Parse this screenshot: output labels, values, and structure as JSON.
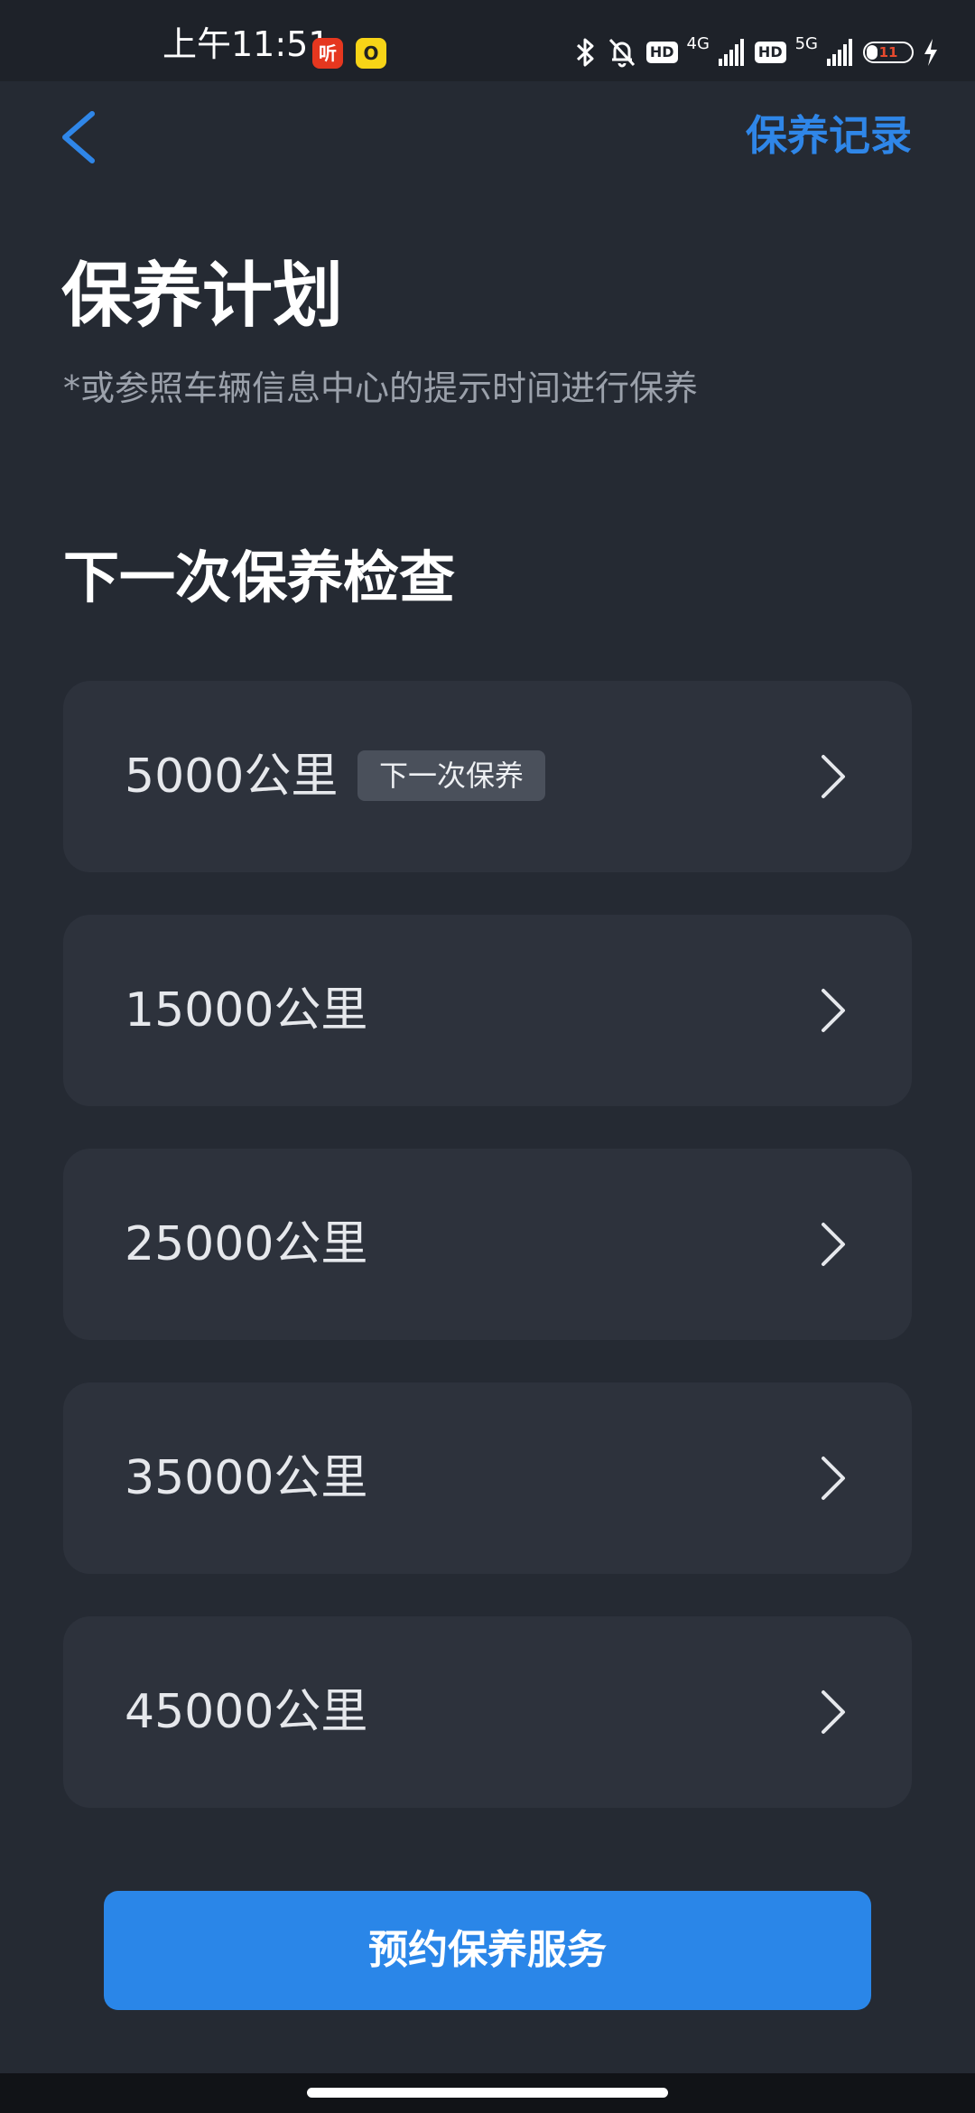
{
  "status_bar": {
    "time": "上午11:51",
    "app_badges": [
      "听",
      "O"
    ],
    "hd_label": "HD",
    "network_4g": "4G",
    "network_5g": "5G",
    "battery_level": "11",
    "icons": [
      "bluetooth-icon",
      "bell-muted-icon",
      "signal-icon",
      "battery-icon",
      "charging-icon"
    ]
  },
  "header": {
    "back_icon": "chevron-left-icon",
    "records_label": "保养记录"
  },
  "page": {
    "title": "保养计划",
    "subtitle": "*或参照车辆信息中心的提示时间进行保养"
  },
  "section": {
    "title": "下一次保养检查"
  },
  "plans": [
    {
      "label": "5000公里",
      "tag": "下一次保养"
    },
    {
      "label": "15000公里",
      "tag": null
    },
    {
      "label": "25000公里",
      "tag": null
    },
    {
      "label": "35000公里",
      "tag": null
    },
    {
      "label": "45000公里",
      "tag": null
    }
  ],
  "footer": {
    "book_button_label": "预约保养服务"
  },
  "colors": {
    "background": "#252a33",
    "card": "#2d323c",
    "accent": "#2f86e8",
    "button": "#2a86e8",
    "tag": "#4a505b",
    "subtitle": "#9ba1ab"
  }
}
